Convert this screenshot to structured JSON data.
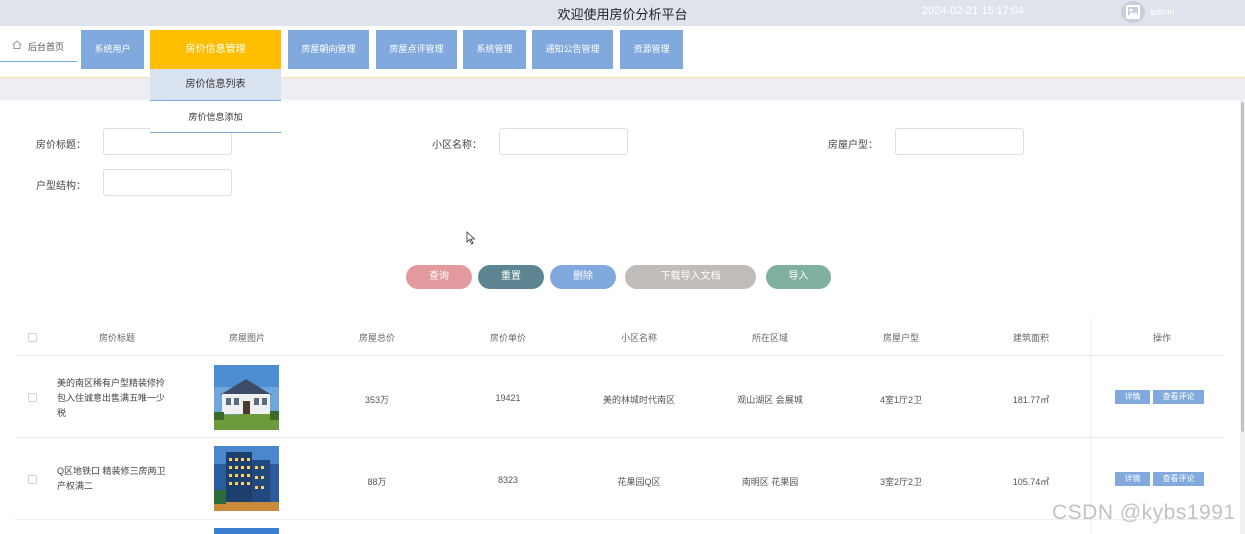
{
  "header": {
    "title": "欢迎使用房价分析平台",
    "datetime": "2024-02-21 15:17:04",
    "user": "admin"
  },
  "nav": {
    "home": "后台首页",
    "items": [
      "系统用户",
      "房价信息管理",
      "房屋朝向管理",
      "房屋点评管理",
      "系统管理",
      "通知公告管理",
      "资源管理"
    ],
    "active": "房价信息管理",
    "dropdown": [
      "房价信息列表",
      "房价信息添加"
    ]
  },
  "search": {
    "fields": [
      {
        "label": "房价标题：",
        "value": ""
      },
      {
        "label": "小区名称：",
        "value": ""
      },
      {
        "label": "房屋户型：",
        "value": ""
      },
      {
        "label": "户型结构：",
        "value": ""
      }
    ]
  },
  "buttons": [
    {
      "label": "查询",
      "color": "#e39a9e"
    },
    {
      "label": "重置",
      "color": "#5c8591"
    },
    {
      "label": "删除",
      "color": "#82a9de"
    },
    {
      "label": "下载导入文档",
      "color": "#c0bcb9"
    },
    {
      "label": "导入",
      "color": "#7fb0a0"
    }
  ],
  "table": {
    "columns": [
      "房价标题",
      "房屋图片",
      "房屋总价",
      "房价单价",
      "小区名称",
      "所在区域",
      "房屋户型",
      "建筑面积",
      "操作"
    ],
    "rows": [
      {
        "title": "美的南区稀有户型精装修拎包入住诚意出售满五唯一少税",
        "image": "house-photo",
        "total": "353万",
        "unit": "19421",
        "community": "美的林城时代南区",
        "area": "观山湖区 会展城",
        "layout": "4室1厅2卫",
        "size": "181.77㎡"
      },
      {
        "title": "Q区地铁口 精装修三房两卫 产权满二",
        "image": "tower-photo",
        "total": "88万",
        "unit": "8323",
        "community": "花果园Q区",
        "area": "南明区 花果园",
        "layout": "3室2厅2卫",
        "size": "105.74㎡"
      }
    ],
    "actions": [
      "详情",
      "查看评论"
    ]
  },
  "watermark": "CSDN @kybs1991",
  "colors": {
    "nav_item": "#82a9de",
    "nav_active": "#ffbf00",
    "header_bg": "#dfe3ec"
  }
}
